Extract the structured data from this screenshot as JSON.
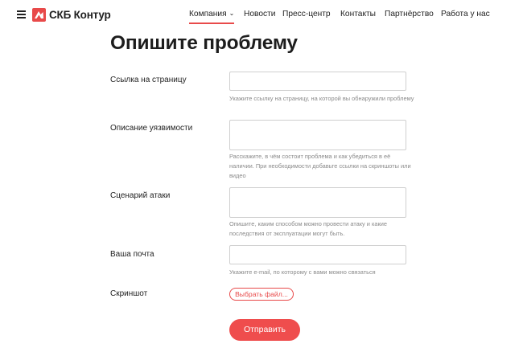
{
  "header": {
    "logo_text": "СКБ Контур",
    "nav": [
      {
        "label": "Компания"
      },
      {
        "label": "Новости"
      },
      {
        "label": "Пресс-центр"
      },
      {
        "label": "Контакты"
      },
      {
        "label": "Партнёрство"
      },
      {
        "label": "Работа у нас"
      }
    ],
    "accent_color": "#e84a4a"
  },
  "form": {
    "title": "Опишите проблему",
    "fields": [
      {
        "label": "Ссылка на страницу",
        "value": "",
        "hint": "Укажите ссылку на страницу, на которой вы обнаружили проблему"
      },
      {
        "label": "Описание уязвимости",
        "value": "",
        "hint": "Расскажите, в чём состоит проблема и как убедиться в её наличии. При необходимости добавьте ссылки на скриншоты или видео"
      },
      {
        "label": "Сценарий атаки",
        "value": "",
        "hint": "Опишите, каким способом можно провести атаку и какие последствия от эксплуатации могут быть."
      },
      {
        "label": "Ваша почта",
        "value": "",
        "hint": "Укажите e-mail, по которому с вами можно связаться"
      }
    ],
    "screenshot_label": "Скриншот",
    "file_button": "Выбрать файл...",
    "submit_button": "Отправить"
  }
}
